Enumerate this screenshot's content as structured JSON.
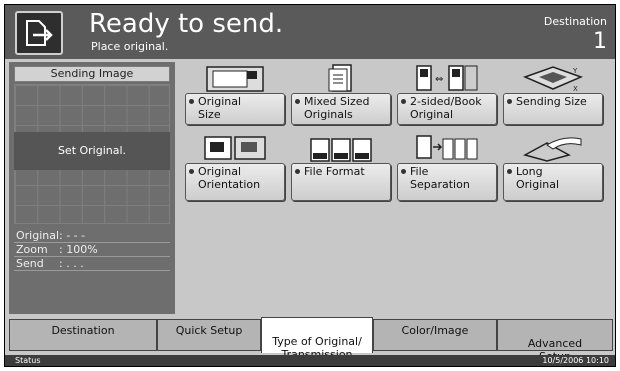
{
  "header": {
    "title": "Ready to send.",
    "subtitle": "Place original.",
    "destination_label": "Destination",
    "destination_count": "1"
  },
  "preview": {
    "title": "Sending Image",
    "message": "Set Original.",
    "info": [
      {
        "key": "Original",
        "value": ":  - - -"
      },
      {
        "key": "Zoom",
        "value": ":  100%"
      },
      {
        "key": "Send",
        "value": ":  . . ."
      }
    ]
  },
  "functions": [
    {
      "label": "Original\nSize",
      "icon": "original-size-icon"
    },
    {
      "label": "Mixed Sized\nOriginals",
      "icon": "mixed-sized-originals-icon"
    },
    {
      "label": "2-sided/Book\nOriginal",
      "icon": "two-sided-book-icon"
    },
    {
      "label": "Sending Size",
      "icon": "sending-size-icon"
    },
    {
      "label": "Original\nOrientation",
      "icon": "original-orientation-icon"
    },
    {
      "label": "File Format",
      "icon": "file-format-icon"
    },
    {
      "label": "File\nSeparation",
      "icon": "file-separation-icon"
    },
    {
      "label": "Long\nOriginal",
      "icon": "long-original-icon"
    }
  ],
  "tabs": [
    {
      "label": "Destination"
    },
    {
      "label": "Quick Setup"
    },
    {
      "label": "Type of Original/\nTransmission"
    },
    {
      "label": "Color/Image"
    },
    {
      "label": "Advanced\nSetup"
    }
  ],
  "status": {
    "label": "Status",
    "datetime": "10/5/2006   10:10"
  }
}
